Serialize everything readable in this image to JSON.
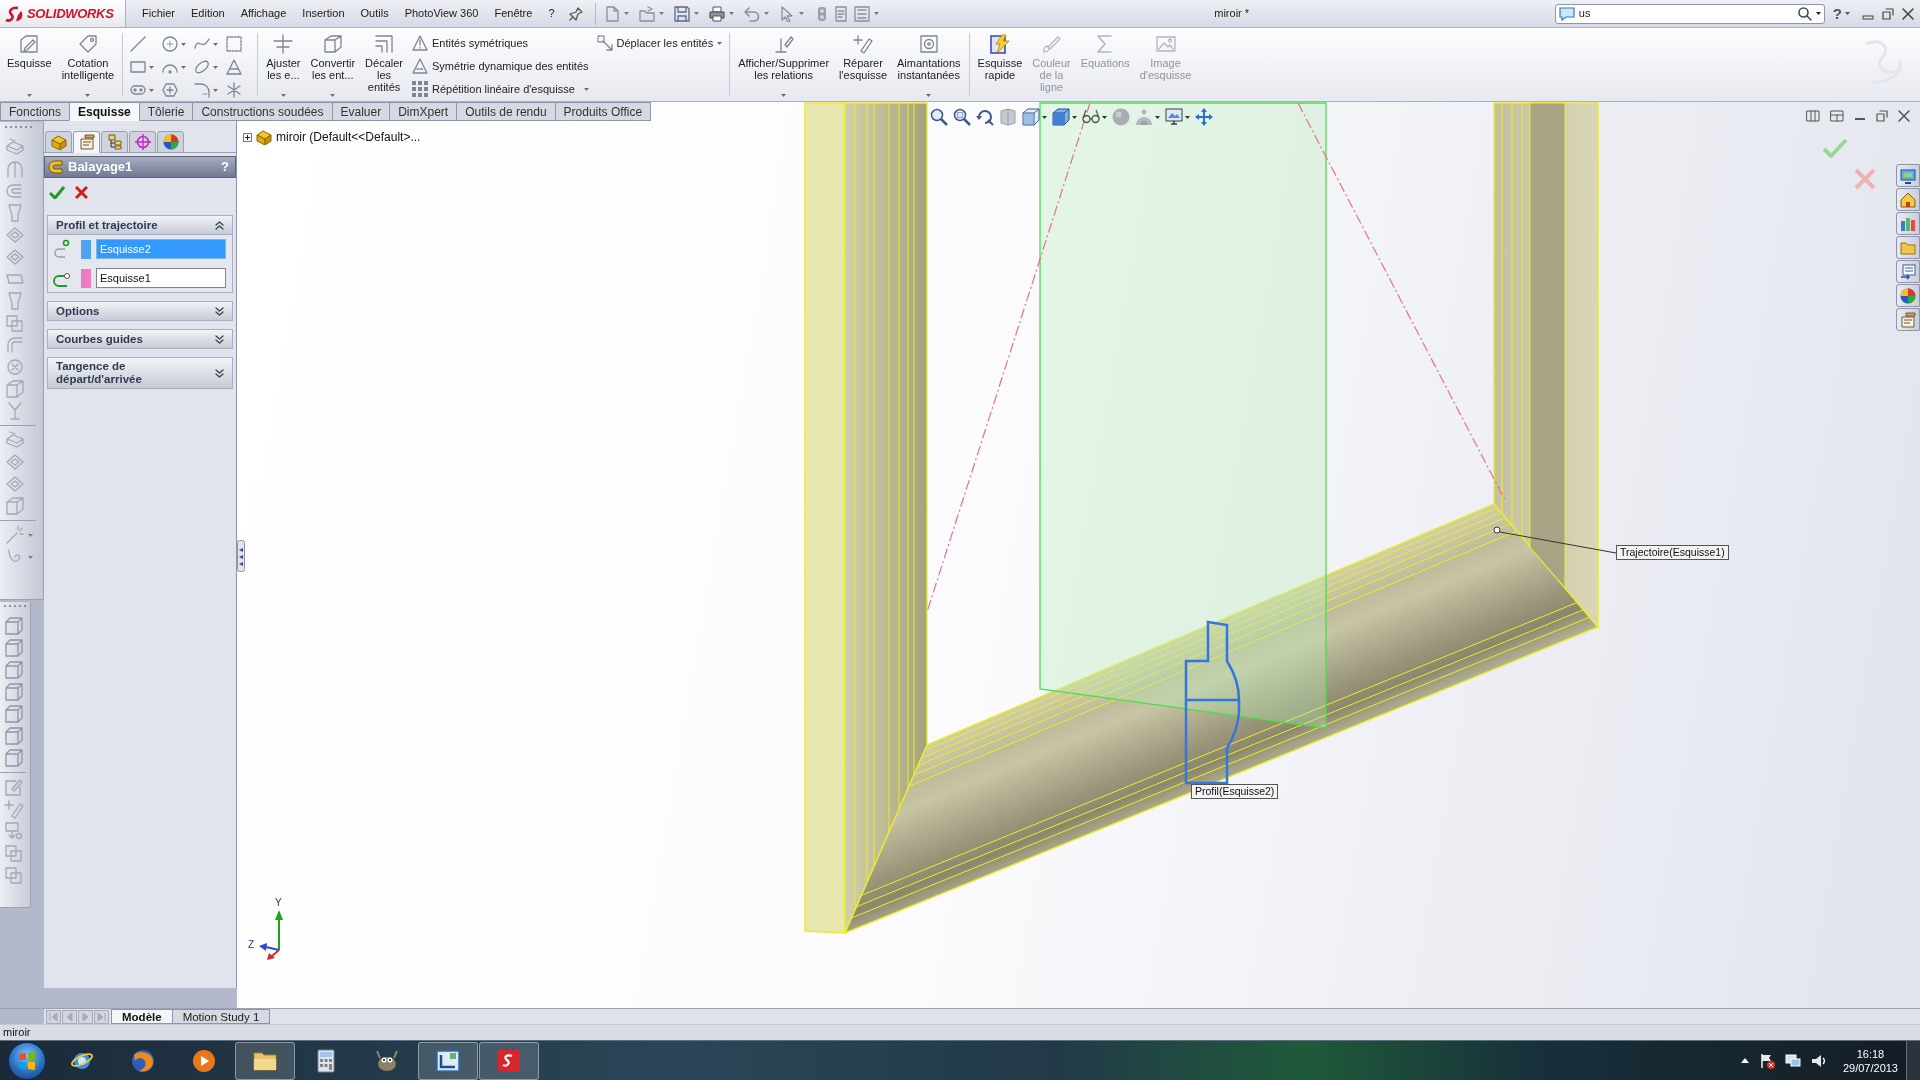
{
  "app_name": "SOLIDWORKS",
  "menu": [
    "Fichier",
    "Edition",
    "Affichage",
    "Insertion",
    "Outils",
    "PhotoView 360",
    "Fenêtre",
    "?"
  ],
  "window": {
    "title": "miroir *"
  },
  "search": {
    "value": "us"
  },
  "help_button": "?",
  "ribbon": [
    [
      {
        "kind": "large",
        "label": "Esquisse",
        "dropdown": true,
        "disabled": false
      },
      {
        "kind": "large",
        "label": "Cotation\nintelligente",
        "dropdown": true,
        "disabled": false
      }
    ],
    [
      {
        "kind": "large",
        "label": "Ajuster\nles e...",
        "dropdown": true,
        "disabled": false
      },
      {
        "kind": "large",
        "label": "Convertir\nles ent...",
        "dropdown": true,
        "disabled": false
      },
      {
        "kind": "large",
        "label": "Décaler\nles\nentités",
        "dropdown": false,
        "disabled": false
      },
      {
        "kind": "small",
        "label": "Entités symétriques",
        "dropdown": false,
        "disabled": false
      },
      {
        "kind": "small",
        "label": "Symétrie dynamique des entités",
        "dropdown": false,
        "disabled": false
      },
      {
        "kind": "small",
        "label": "Répétition linéaire d'esquisse",
        "dropdown": true,
        "disabled": false
      },
      {
        "kind": "small",
        "label": "Déplacer les entités",
        "dropdown": true,
        "disabled": false
      }
    ],
    [
      {
        "kind": "large",
        "label": "Afficher/Supprimer\nles relations",
        "dropdown": true,
        "disabled": false
      },
      {
        "kind": "large",
        "label": "Réparer\nl'esquisse",
        "dropdown": false,
        "disabled": false
      },
      {
        "kind": "large",
        "label": "Aimantations\ninstantanées",
        "dropdown": true,
        "disabled": false
      }
    ],
    [
      {
        "kind": "large",
        "label": "Esquisse\nrapide",
        "dropdown": false,
        "disabled": false
      },
      {
        "kind": "large",
        "label": "Couleur\nde la\nligne",
        "dropdown": false,
        "disabled": true
      },
      {
        "kind": "large",
        "label": "Equations",
        "dropdown": false,
        "disabled": true
      },
      {
        "kind": "large",
        "label": "Image\nd'esquisse",
        "dropdown": false,
        "disabled": true
      }
    ]
  ],
  "tabs": [
    {
      "label": "Fonctions",
      "selected": false
    },
    {
      "label": "Esquisse",
      "selected": true
    },
    {
      "label": "Tôlerie",
      "selected": false
    },
    {
      "label": "Constructions soudées",
      "selected": false
    },
    {
      "label": "Evaluer",
      "selected": false
    },
    {
      "label": "DimXpert",
      "selected": false
    },
    {
      "label": "Outils de rendu",
      "selected": false
    },
    {
      "label": "Produits Office",
      "selected": false
    }
  ],
  "panel": {
    "manager_tabs": [
      {
        "selected": false
      },
      {
        "selected": true
      },
      {
        "selected": false
      },
      {
        "selected": false
      },
      {
        "selected": false
      }
    ],
    "title": "Balayage1",
    "help": "?",
    "sections": [
      {
        "title": "Profil et trajectoire",
        "expanded": true,
        "fields": [
          {
            "value": "Esquisse2",
            "selected": true,
            "color": "#4fa3f5"
          },
          {
            "value": "Esquisse1",
            "selected": false,
            "color": "#f07cc0"
          }
        ]
      },
      {
        "title": "Options",
        "expanded": false
      },
      {
        "title": "Courbes guides",
        "expanded": false
      },
      {
        "title": "Tangence de départ/d'arrivée",
        "expanded": false
      }
    ]
  },
  "tree": [
    {
      "label": "miroir (Default<<Default>...",
      "expanded": false
    }
  ],
  "viewport": {
    "callouts": [
      {
        "label": "Trajectoire(Esquisse1)"
      },
      {
        "label": "Profil(Esquisse2)"
      }
    ],
    "axes": [
      {
        "label": "Y"
      },
      {
        "label": "Z"
      }
    ]
  },
  "bottom_tabs": [
    {
      "label": "Modèle",
      "selected": true
    },
    {
      "label": "Motion Study 1",
      "selected": false
    }
  ],
  "status_bar": {
    "text": "miroir"
  },
  "taskbar": {
    "apps": [
      {
        "running": false
      },
      {
        "running": false
      },
      {
        "running": false
      },
      {
        "running": true
      },
      {
        "running": false
      },
      {
        "running": false
      },
      {
        "running": true
      },
      {
        "running": true
      }
    ],
    "time": "16:18",
    "date": "29/07/2013"
  }
}
